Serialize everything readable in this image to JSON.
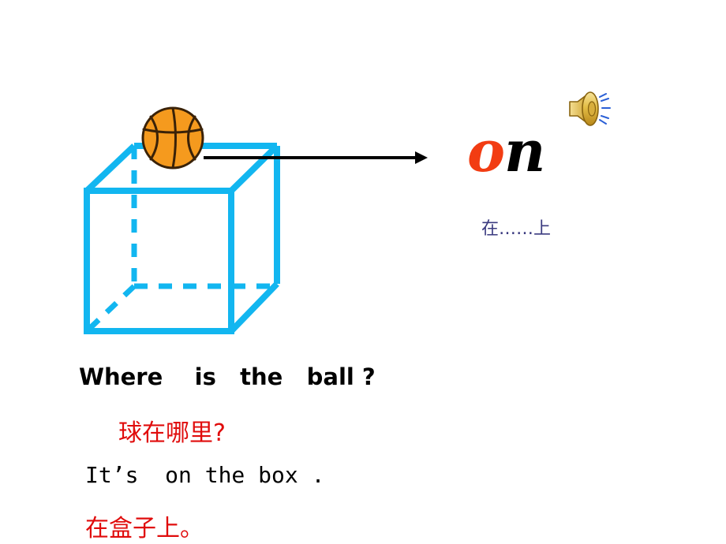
{
  "slide": {
    "background_color": "#FFFFFF",
    "title_word": {
      "first_letter": "o",
      "rest": "n",
      "full": "on",
      "first_letter_color": "#F23C12",
      "rest_color": "#000000"
    },
    "gloss": {
      "text": "在……上",
      "color": "#3B3B80"
    },
    "speaker": {
      "icon": "speaker-sound-icon",
      "body_color": "#D9A82A",
      "wave_color": "#2A5FD6"
    },
    "illustration": {
      "cube": {
        "label": "box",
        "edge_color": "#12B6F0",
        "visible_edge_style": "solid",
        "hidden_edge_style": "dashed"
      },
      "ball": {
        "label": "basketball",
        "fill_color": "#F59A1E",
        "seam_color": "#5B3A16"
      },
      "arrow": {
        "icon": "arrow-right-icon",
        "color": "#000000"
      }
    },
    "question_en": "Where    is   the   ball ?",
    "question_zh": "球在哪里?",
    "answer_en": "It’s  on the box .",
    "answer_zh": "在盒子上。",
    "question_en_color": "#000000",
    "question_zh_color": "#E00C0C",
    "answer_en_color": "#000000",
    "answer_zh_color": "#E00C0C"
  }
}
